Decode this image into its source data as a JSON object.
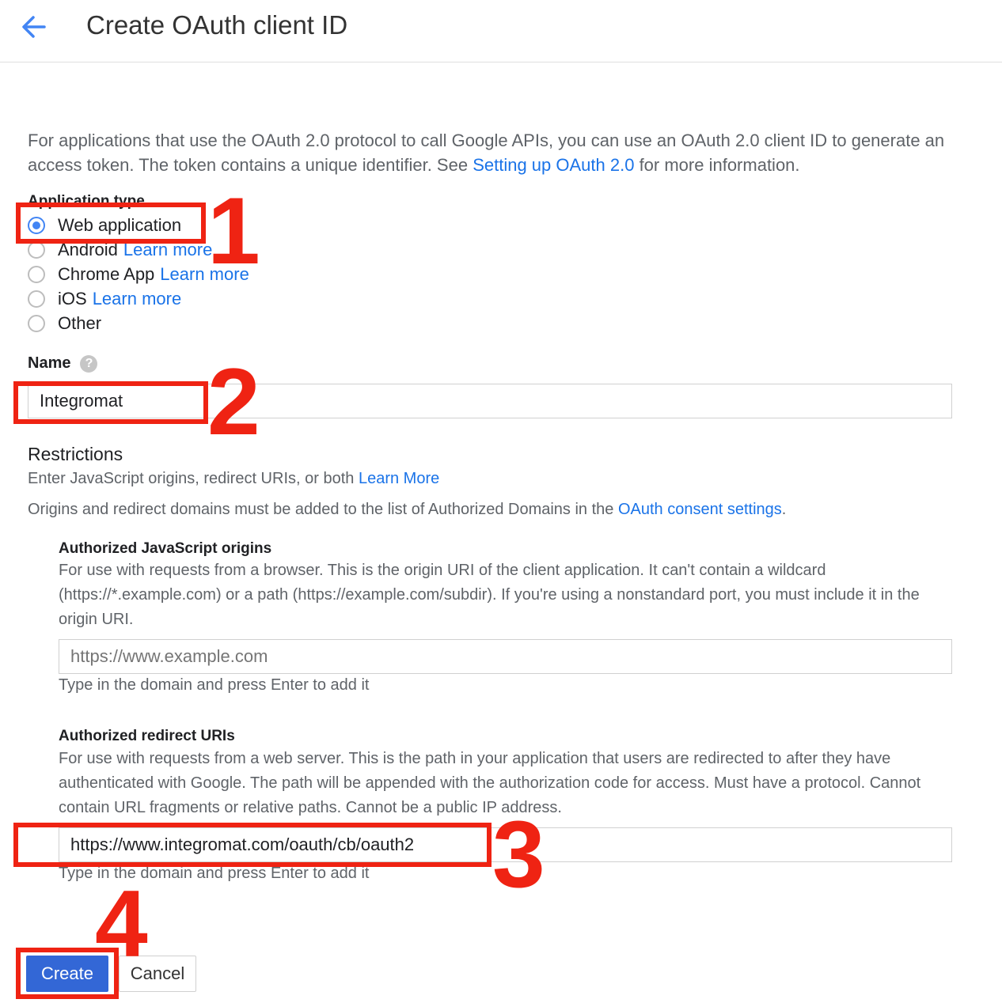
{
  "header": {
    "title": "Create OAuth client ID",
    "back_icon": "arrow-left-icon"
  },
  "intro": {
    "text_before": "For applications that use the OAuth 2.0 protocol to call Google APIs, you can use an OAuth 2.0 client ID to generate an access token. The token contains a unique identifier. See ",
    "link": "Setting up OAuth 2.0",
    "text_after": " for more information."
  },
  "app_type": {
    "label": "Application type",
    "options": [
      {
        "label": "Web application",
        "link": "",
        "checked": true
      },
      {
        "label": "Android",
        "link": "Learn more",
        "checked": false
      },
      {
        "label": "Chrome App",
        "link": "Learn more",
        "checked": false
      },
      {
        "label": "iOS",
        "link": "Learn more",
        "checked": false
      },
      {
        "label": "Other",
        "link": "",
        "checked": false
      }
    ]
  },
  "name": {
    "label": "Name",
    "value": "Integromat",
    "help_icon": "help-icon"
  },
  "restrictions": {
    "title": "Restrictions",
    "line1_text": "Enter JavaScript origins, redirect URIs, or both ",
    "line1_link": "Learn More",
    "line2_text": "Origins and redirect domains must be added to the list of Authorized Domains in the ",
    "line2_link": "OAuth consent settings",
    "line2_after": "."
  },
  "js_origins": {
    "title": "Authorized JavaScript origins",
    "description": "For use with requests from a browser. This is the origin URI of the client application. It can't contain a wildcard (https://*.example.com) or a path (https://example.com/subdir). If you're using a nonstandard port, you must include it in the origin URI.",
    "placeholder": "https://www.example.com",
    "hint": "Type in the domain and press Enter to add it"
  },
  "redirect_uris": {
    "title": "Authorized redirect URIs",
    "description": "For use with requests from a web server. This is the path in your application that users are redirected to after they have authenticated with Google. The path will be appended with the authorization code for access. Must have a protocol. Cannot contain URL fragments or relative paths. Cannot be a public IP address.",
    "value": "https://www.integromat.com/oauth/cb/oauth2",
    "hint": "Type in the domain and press Enter to add it"
  },
  "actions": {
    "create_label": "Create",
    "cancel_label": "Cancel"
  },
  "annotations": [
    "1",
    "2",
    "3",
    "4"
  ],
  "colors": {
    "accent": "#1a73e8",
    "button": "#3367d6",
    "annotation": "#ef2313"
  }
}
